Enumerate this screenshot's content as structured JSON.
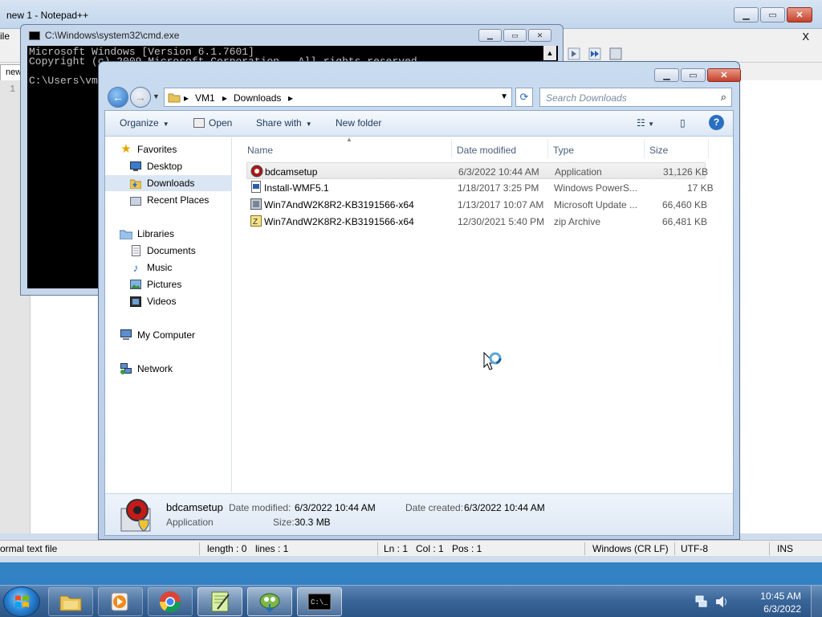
{
  "notepadpp": {
    "title": "new 1 - Notepad++",
    "menu_file": "ile",
    "close_doc": "X",
    "tab_label": "new",
    "line_number": "1",
    "status": {
      "filetype": "ormal text file",
      "length": "length : 0",
      "lines": "lines : 1",
      "ln": "Ln : 1",
      "col": "Col : 1",
      "pos": "Pos : 1",
      "eol": "Windows (CR LF)",
      "encoding": "UTF-8",
      "mode": "INS"
    }
  },
  "cmd": {
    "title": "C:\\Windows\\system32\\cmd.exe",
    "lines": [
      "Microsoft Windows [Version 6.1.7601]",
      "Copyright (c) 2009 Microsoft Corporation.  All rights reserved.",
      "",
      "C:\\Users\\vm"
    ]
  },
  "explorer": {
    "breadcrumb": [
      "VM1",
      "Downloads"
    ],
    "search_placeholder": "Search Downloads",
    "toolbar": {
      "organize": "Organize",
      "open": "Open",
      "share_with": "Share with",
      "new_folder": "New folder"
    },
    "nav": {
      "favorites": "Favorites",
      "desktop": "Desktop",
      "downloads": "Downloads",
      "recent_places": "Recent Places",
      "libraries": "Libraries",
      "documents": "Documents",
      "music": "Music",
      "pictures": "Pictures",
      "videos": "Videos",
      "my_computer": "My Computer",
      "network": "Network"
    },
    "columns": {
      "name": "Name",
      "date": "Date modified",
      "type": "Type",
      "size": "Size"
    },
    "files": [
      {
        "name": "bdcamsetup",
        "date": "6/3/2022 10:44 AM",
        "type": "Application",
        "size": "31,126 KB",
        "icon": "bdcam-icon"
      },
      {
        "name": "Install-WMF5.1",
        "date": "1/18/2017 3:25 PM",
        "type": "Windows PowerS...",
        "size": "17 KB",
        "icon": "powershell-script-icon"
      },
      {
        "name": "Win7AndW2K8R2-KB3191566-x64",
        "date": "1/13/2017 10:07 AM",
        "type": "Microsoft Update ...",
        "size": "66,460 KB",
        "icon": "msu-package-icon"
      },
      {
        "name": "Win7AndW2K8R2-KB3191566-x64",
        "date": "12/30/2021 5:40 PM",
        "type": "zip Archive",
        "size": "66,481 KB",
        "icon": "zip-archive-icon"
      }
    ],
    "details": {
      "name": "bdcamsetup",
      "type": "Application",
      "date_modified_label": "Date modified:",
      "date_modified": "6/3/2022 10:44 AM",
      "date_created_label": "Date created:",
      "date_created": "6/3/2022 10:44 AM",
      "size_label": "Size:",
      "size": "30.3 MB"
    }
  },
  "taskbar": {
    "clock_time": "10:45 AM",
    "clock_date": "6/3/2022",
    "items": [
      "explorer-icon",
      "media-player-icon",
      "chrome-icon",
      "notepadpp-icon",
      "setup-icon",
      "cmd-icon"
    ]
  }
}
